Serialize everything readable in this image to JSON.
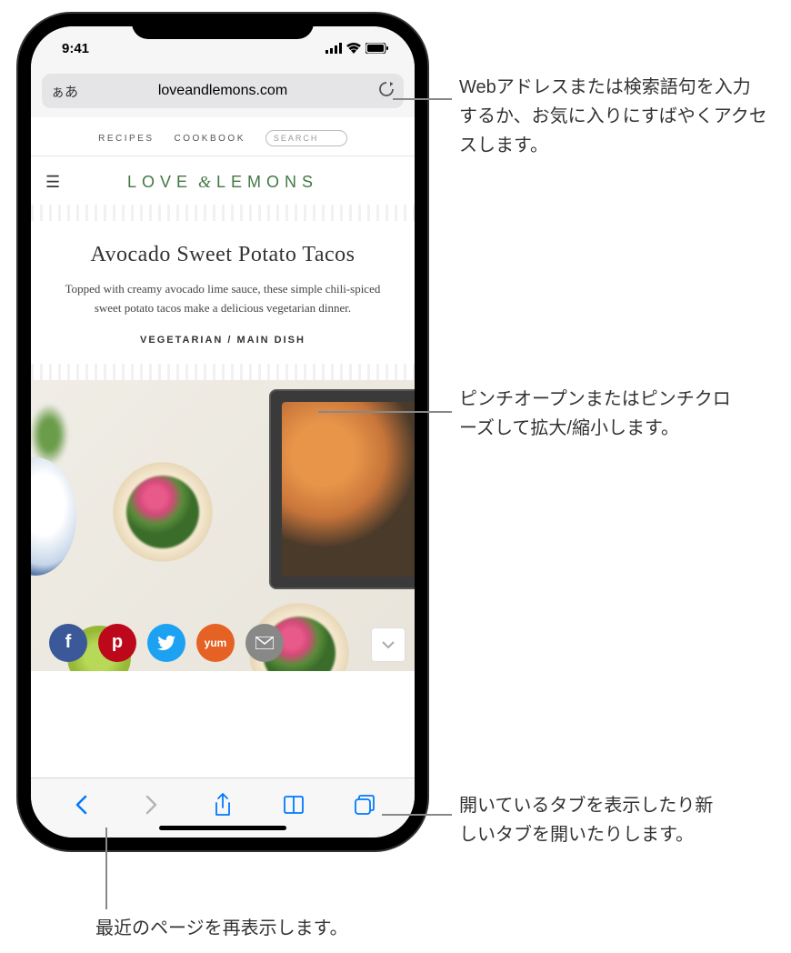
{
  "status": {
    "time": "9:41"
  },
  "url": {
    "aa_label": "ぁあ",
    "domain": "loveandlemons.com"
  },
  "site": {
    "nav": {
      "recipes": "RECIPES",
      "cookbook": "COOKBOOK",
      "search": "SEARCH"
    },
    "logo": {
      "love": "LOVE",
      "amp": "&",
      "lemons": "LEMONS"
    }
  },
  "article": {
    "title": "Avocado Sweet Potato Tacos",
    "desc": "Topped with creamy avocado lime sauce, these simple chili-spiced sweet potato tacos make a delicious vegetarian dinner.",
    "categories": "VEGETARIAN / MAIN DISH"
  },
  "share": {
    "facebook": "f",
    "pinterest": "p",
    "twitter": "t",
    "yum": "yum",
    "email": "✉"
  },
  "callouts": {
    "urlbar": "Webアドレスまたは検索語句を入力するか、お気に入りにすばやくアクセスします。",
    "pinch": "ピンチオープンまたはピンチクローズして拡大/縮小します。",
    "tabs": "開いているタブを表示したり新しいタブを開いたりします。",
    "recent": "最近のページを再表示します。"
  }
}
